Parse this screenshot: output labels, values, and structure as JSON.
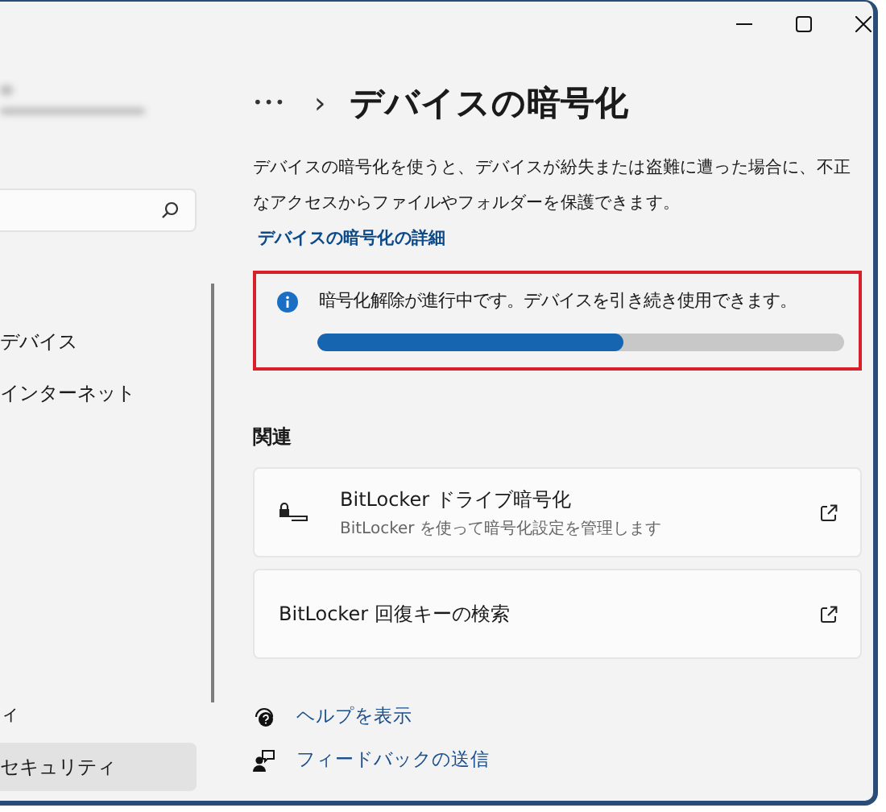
{
  "sidebar": {
    "items": [
      {
        "label": "デバイス",
        "selected": false
      },
      {
        "label": "インターネット",
        "selected": false
      },
      {
        "label": "ィ",
        "selected": false
      },
      {
        "label": "セキュリティ",
        "selected": true
      }
    ]
  },
  "breadcrumb": {
    "more": "•••",
    "separator": "›",
    "title": "デバイスの暗号化"
  },
  "description": {
    "text": "デバイスの暗号化を使うと、デバイスが紛失または盗難に遭った場合に、不正なアクセスからファイルやフォルダーを保護できます。",
    "link": "デバイスの暗号化の詳細"
  },
  "status": {
    "message": "暗号化解除が進行中です。デバイスを引き続き使用できます。",
    "level": 0.58,
    "highlighted": true
  },
  "related": {
    "heading": "関連",
    "cards": [
      {
        "kind": "icon",
        "title": "BitLocker ドライブ暗号化",
        "subtitle": "BitLocker を使って暗号化設定を管理します"
      },
      {
        "kind": "plain",
        "title": "BitLocker 回復キーの検索"
      }
    ]
  },
  "help_links": [
    {
      "kind": "help",
      "label": "ヘルプを表示"
    },
    {
      "kind": "feedback",
      "label": "フィードバックの送信"
    }
  ]
}
